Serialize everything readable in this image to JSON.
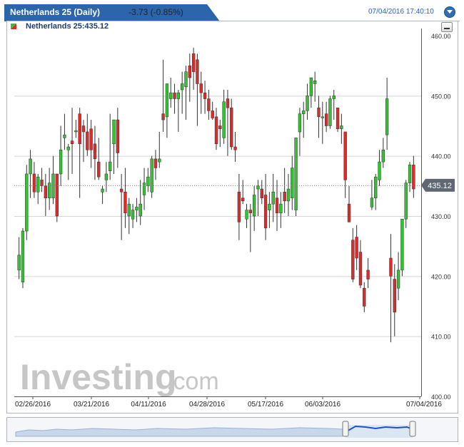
{
  "header": {
    "instrument_title": "Netherlands 25 (Daily)",
    "change": "-3.73 (-0.85%)",
    "datetime": "07/04/2016 17:40:10"
  },
  "legend": {
    "label": "Netherlands 25:435.12"
  },
  "watermark": {
    "brand": "Investing",
    "suffix": ".com"
  },
  "colors": {
    "up": "#32c232",
    "down": "#dd2a2a",
    "tab": "#2d65ad",
    "price_tag": "#5f6872"
  },
  "chart_data": {
    "type": "candlestick",
    "ylim": [
      400,
      460
    ],
    "yticks": [
      "460.00",
      "450.00",
      "440.00",
      "430.00",
      "420.00",
      "410.00",
      "400.00"
    ],
    "xtick_labels": [
      "02/26/2016",
      "03/21/2016",
      "04/11/2016",
      "04/28/2016",
      "05/17/2016",
      "06/03/2016",
      "07/04/2016"
    ],
    "last_price": "435.12",
    "candles": [
      [
        421.0,
        426.5,
        419.5,
        423.5
      ],
      [
        419.0,
        428.0,
        418.0,
        427.5
      ],
      [
        427.5,
        438.5,
        426.0,
        437.0
      ],
      [
        437.0,
        441.0,
        433.0,
        439.5
      ],
      [
        437.0,
        439.0,
        433.0,
        434.0
      ],
      [
        434.0,
        437.0,
        432.0,
        436.5
      ],
      [
        436.0,
        438.0,
        434.0,
        435.0
      ],
      [
        435.0,
        437.0,
        430.0,
        433.0
      ],
      [
        433.0,
        438.0,
        431.0,
        435.5
      ],
      [
        433.0,
        440.0,
        432.0,
        437.0
      ],
      [
        437.0,
        436.0,
        429.0,
        430.0
      ],
      [
        437.0,
        445.0,
        435.0,
        441.0
      ],
      [
        443.0,
        447.0,
        441.0,
        443.5
      ],
      [
        441.0,
        442.0,
        436.0,
        441.5
      ],
      [
        442.5,
        448.0,
        437.0,
        442.0
      ],
      [
        444.0,
        446.0,
        443.0,
        444.2
      ],
      [
        447.0,
        448.0,
        433.0,
        442.0
      ],
      [
        445.0,
        446.0,
        439.0,
        444.0
      ],
      [
        444.0,
        447.0,
        440.0,
        441.0
      ],
      [
        444.5,
        446.0,
        438.0,
        441.0
      ],
      [
        442.0,
        445.0,
        436.0,
        439.5
      ],
      [
        439.0,
        443.0,
        436.0,
        436.5
      ],
      [
        434.0,
        435.0,
        432.0,
        434.5
      ],
      [
        436.0,
        439.0,
        434.0,
        437.0
      ],
      [
        437.5,
        447.0,
        436.0,
        439.0
      ],
      [
        442.0,
        444.5,
        437.0,
        446.0
      ],
      [
        446.0,
        448.0,
        438.0,
        440.5
      ],
      [
        434.5,
        437.0,
        426.0,
        434.0
      ],
      [
        434.0,
        438.0,
        428.0,
        430.5
      ],
      [
        430.0,
        433.0,
        427.0,
        432.0
      ],
      [
        429.5,
        432.0,
        428.0,
        431.0
      ],
      [
        431.0,
        433.0,
        429.0,
        431.5
      ],
      [
        430.0,
        436.0,
        428.5,
        432.0
      ],
      [
        433.5,
        438.0,
        431.0,
        435.5
      ],
      [
        435.0,
        438.0,
        434.0,
        436.5
      ],
      [
        434.0,
        440.0,
        433.0,
        439.5
      ],
      [
        439.5,
        441.0,
        436.0,
        438.0
      ],
      [
        439.0,
        444.0,
        438.0,
        439.5
      ],
      [
        447.0,
        456.0,
        444.0,
        446.0
      ],
      [
        446.5,
        451.0,
        443.0,
        452.0
      ],
      [
        449.5,
        453.0,
        448.0,
        450.5
      ],
      [
        450.5,
        452.0,
        447.0,
        449.5
      ],
      [
        449.5,
        451.0,
        444.0,
        450.5
      ],
      [
        451.0,
        454.0,
        447.0,
        452.0
      ],
      [
        451.5,
        455.0,
        446.0,
        454.0
      ],
      [
        455.0,
        457.0,
        449.0,
        453.0
      ],
      [
        457.0,
        458.0,
        451.0,
        454.0
      ],
      [
        456.0,
        457.0,
        445.0,
        452.0
      ],
      [
        452.0,
        454.0,
        447.0,
        450.5
      ],
      [
        450.5,
        452.5,
        447.0,
        449.5
      ],
      [
        449.5,
        451.0,
        446.0,
        447.5
      ],
      [
        447.5,
        449.0,
        446.0,
        446.3
      ],
      [
        446.5,
        448.0,
        441.0,
        442.0
      ],
      [
        445.0,
        446.0,
        441.5,
        444.5
      ],
      [
        443.0,
        451.0,
        442.0,
        449.0
      ],
      [
        449.5,
        451.0,
        440.0,
        448.0
      ],
      [
        448.0,
        449.5,
        441.0,
        441.5
      ],
      [
        441.5,
        444.0,
        439.0,
        441.0
      ],
      [
        434.0,
        437.0,
        426.0,
        429.0
      ],
      [
        433.0,
        436.0,
        432.0,
        432.5
      ],
      [
        429.5,
        432.0,
        428.0,
        431.0
      ],
      [
        431.0,
        432.0,
        424.0,
        430.5
      ],
      [
        430.0,
        435.0,
        427.5,
        433.5
      ],
      [
        434.5,
        436.0,
        430.0,
        435.0
      ],
      [
        434.5,
        436.0,
        432.0,
        433.0
      ],
      [
        433.5,
        437.0,
        426.0,
        428.0
      ],
      [
        431.0,
        434.0,
        428.0,
        432.0
      ],
      [
        432.0,
        437.0,
        429.0,
        434.0
      ],
      [
        433.0,
        436.0,
        427.5,
        430.5
      ],
      [
        430.5,
        434.0,
        428.0,
        432.0
      ],
      [
        434.0,
        438.0,
        430.5,
        432.5
      ],
      [
        432.5,
        437.0,
        430.0,
        434.5
      ],
      [
        433.0,
        440.0,
        431.0,
        438.0
      ],
      [
        431.0,
        442.0,
        430.0,
        443.0
      ],
      [
        444.0,
        448.0,
        440.0,
        447.0
      ],
      [
        447.0,
        449.0,
        443.0,
        447.5
      ],
      [
        447.5,
        452.0,
        446.0,
        450.0
      ],
      [
        450.0,
        453.0,
        448.0,
        453.0
      ],
      [
        452.0,
        454.0,
        449.0,
        452.5
      ],
      [
        448.0,
        450.0,
        443.0,
        446.5
      ],
      [
        446.5,
        449.0,
        442.0,
        446.5
      ],
      [
        447.0,
        449.0,
        444.0,
        445.0
      ],
      [
        445.0,
        450.0,
        444.5,
        449.5
      ],
      [
        449.5,
        451.0,
        446.0,
        450.0
      ],
      [
        448.0,
        448.0,
        444.0,
        444.5
      ],
      [
        444.5,
        447.0,
        442.0,
        445.0
      ],
      [
        444.0,
        436.0,
        433.0,
        436.0
      ],
      [
        432.0,
        435.0,
        430.0,
        429.0
      ],
      [
        426.0,
        428.0,
        419.0,
        419.5
      ],
      [
        426.5,
        428.5,
        421.0,
        423.0
      ],
      [
        424.0,
        426.0,
        418.0,
        418.5
      ],
      [
        418.0,
        419.0,
        414.0,
        415.0
      ],
      [
        421.0,
        423.0,
        418.0,
        419.5
      ],
      [
        431.5,
        436.0,
        431.0,
        433.0
      ],
      [
        433.0,
        437.0,
        431.0,
        436.5
      ],
      [
        436.0,
        441.0,
        435.0,
        439.0
      ],
      [
        439.0,
        443.0,
        438.0,
        441.0
      ],
      [
        443.5,
        453.0,
        441.0,
        449.5
      ],
      [
        423.0,
        427.0,
        409.0,
        420.0
      ],
      [
        419.5,
        422.0,
        410.0,
        414.0
      ],
      [
        418.0,
        424.0,
        416.0,
        421.0
      ],
      [
        421.0,
        428.0,
        420.0,
        429.5
      ],
      [
        429.5,
        436.0,
        428.0,
        435.5
      ],
      [
        435.5,
        439.0,
        434.0,
        438.5
      ],
      [
        438.5,
        440.0,
        433.0,
        434.5
      ]
    ]
  }
}
